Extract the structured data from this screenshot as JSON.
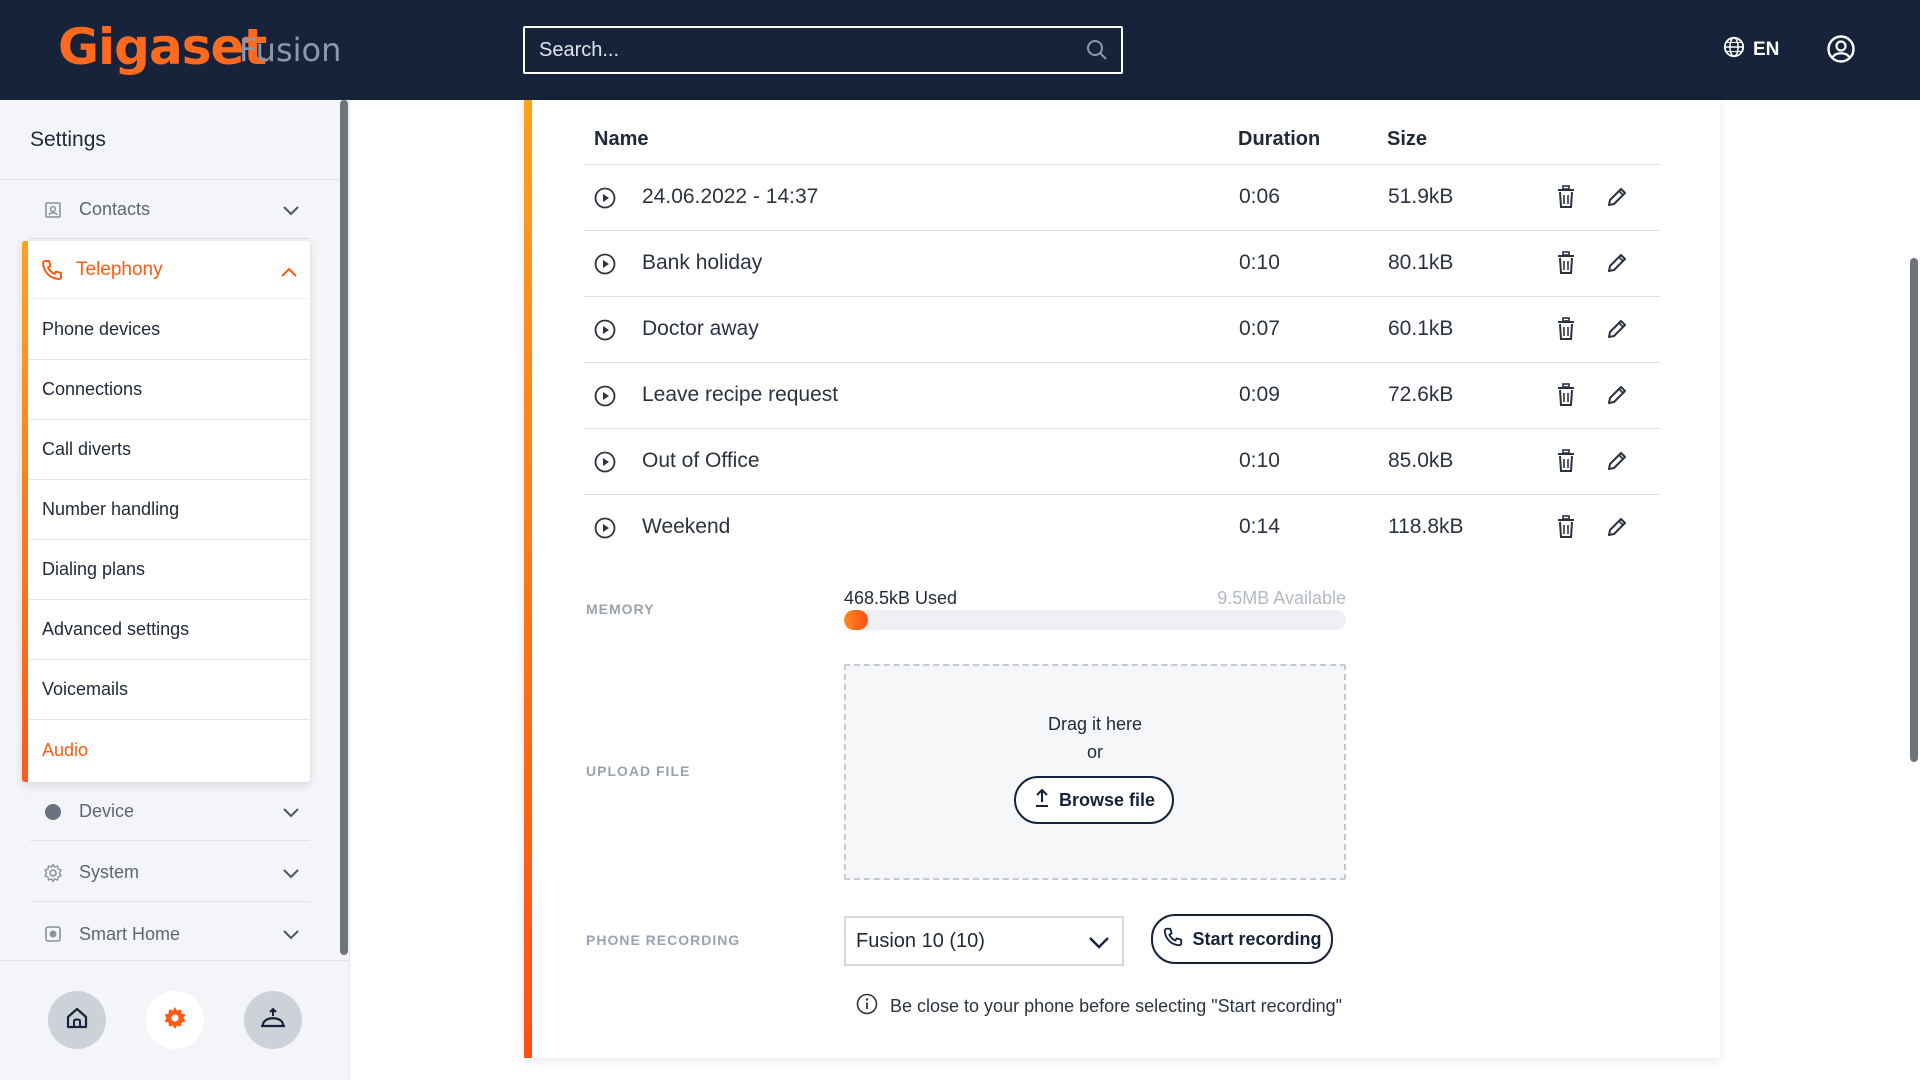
{
  "header": {
    "logo": "Gigaset",
    "product": "Fusion",
    "search_placeholder": "Search...",
    "language": "EN"
  },
  "sidebar": {
    "title": "Settings",
    "categories": [
      {
        "label": "Contacts",
        "icon": "contacts-icon"
      },
      {
        "label": "Telephony",
        "icon": "phone-icon"
      },
      {
        "label": "Device",
        "icon": "device-icon"
      },
      {
        "label": "System",
        "icon": "gear-icon"
      },
      {
        "label": "Smart Home",
        "icon": "smart-home-icon"
      }
    ],
    "telephony_items": [
      "Phone devices",
      "Connections",
      "Call diverts",
      "Number handling",
      "Dialing plans",
      "Advanced settings",
      "Voicemails",
      "Audio"
    ],
    "bottom_buttons": [
      "home-icon",
      "gear-icon",
      "dome-icon"
    ],
    "colors": {
      "accent": "#ff5b12",
      "header_bg": "#17233a"
    }
  },
  "table": {
    "headers": {
      "name": "Name",
      "duration": "Duration",
      "size": "Size"
    },
    "rows": [
      {
        "name": "24.06.2022 - 14:37",
        "duration": "0:06",
        "size": "51.9kB"
      },
      {
        "name": "Bank holiday",
        "duration": "0:10",
        "size": "80.1kB"
      },
      {
        "name": "Doctor away",
        "duration": "0:07",
        "size": "60.1kB"
      },
      {
        "name": "Leave recipe request",
        "duration": "0:09",
        "size": "72.6kB"
      },
      {
        "name": "Out of Office",
        "duration": "0:10",
        "size": "85.0kB"
      },
      {
        "name": "Weekend",
        "duration": "0:14",
        "size": "118.8kB"
      }
    ]
  },
  "memory": {
    "label": "MEMORY",
    "used": "468.5kB Used",
    "available": "9.5MB Available",
    "used_fraction": 0.048
  },
  "upload": {
    "label": "UPLOAD FILE",
    "drag_text": "Drag it here",
    "or_text": "or",
    "browse_label": "Browse file"
  },
  "recording": {
    "label": "PHONE RECORDING",
    "selected_device": "Fusion 10 (10)",
    "start_label": "Start recording",
    "hint": "Be close to your phone before selecting \"Start recording\""
  }
}
